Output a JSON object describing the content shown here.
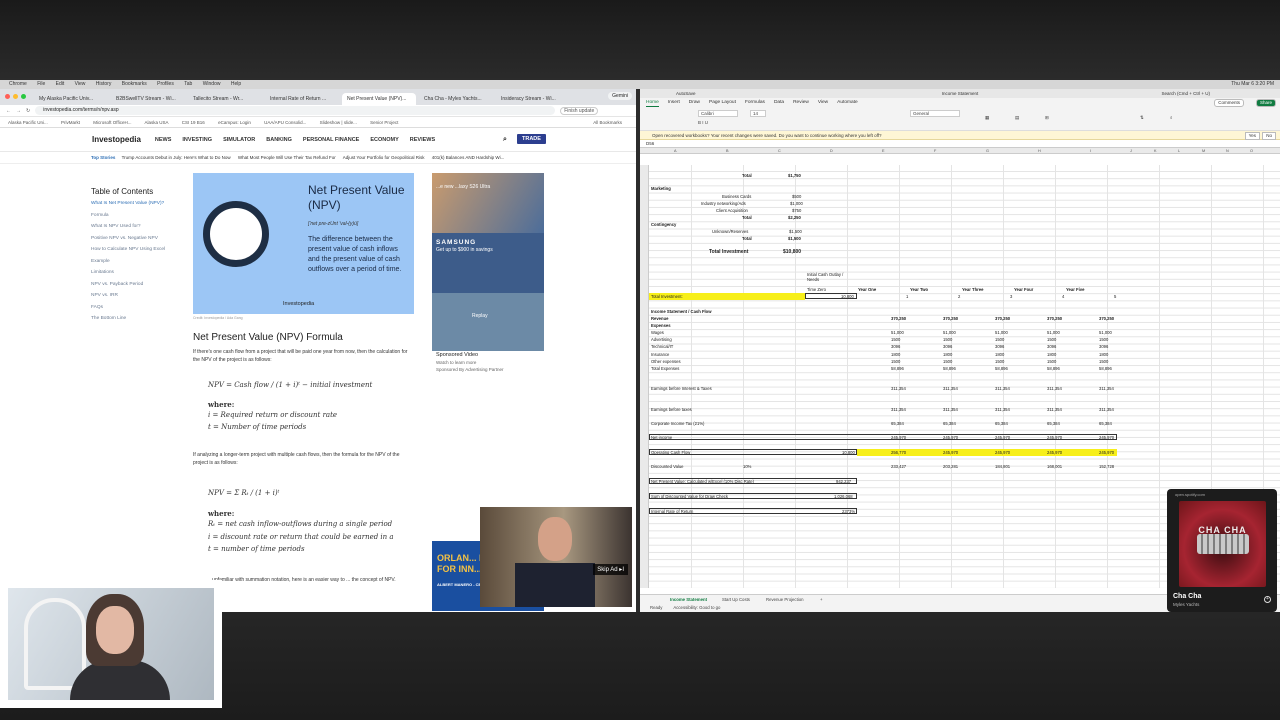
{
  "menubar": {
    "items": [
      "Chrome",
      "File",
      "Edit",
      "View",
      "History",
      "Bookmarks",
      "Profiles",
      "Tab",
      "Window",
      "Help"
    ],
    "clock": "Thu Mar 6  3:20 PM"
  },
  "browser": {
    "tabs": [
      "My Alaska Pacific Univ...",
      "B2BSwellTV Stream - Wi...",
      "Tallecito Stream - Wr...",
      "Internal Rate of Return ...",
      "Net Present Value (NPV)...",
      "Cha Cha - Myles Yachts...",
      "Insideracy Stream - Wi..."
    ],
    "gemini": "Gemini",
    "url": "investopedia.com/terms/n/npv.asp",
    "finish_update": "Finish update",
    "bookmarks": [
      "Alaska Pacific Uni...",
      "PrivMarkt",
      "Microsoft OfficeH...",
      "Alaska USA",
      "CSI 19 B16",
      "eCampus: Login",
      "UAA/APU Consolid...",
      "Slideshow | slide...",
      "Senior Project"
    ],
    "all_bookmarks": "All Bookmarks",
    "logo": "Investopedia",
    "nav": [
      "NEWS",
      "INVESTING",
      "SIMULATOR",
      "BANKING",
      "PERSONAL FINANCE",
      "ECONOMY",
      "REVIEWS"
    ],
    "trade": "TRADE",
    "top_stories_label": "Top Stories",
    "stories": [
      "Trump Accounts Debut in July: Here's What to Do Now",
      "What Most People Will Use Their Tax Refund For",
      "Adjust Your Portfolio for Geopolitical Risk",
      "401(k) Balances AND Hardship Wi..."
    ],
    "toc_title": "Table of Contents",
    "toc": [
      "What Is Net Present Value (NPV)?",
      "Formula",
      "What Is NPV Used for?",
      "Positive NPV vs. Negative NPV",
      "How to Calculate NPV Using Excel",
      "Example",
      "Limitations",
      "NPV vs. Payback Period",
      "NPV vs. IRR",
      "FAQs",
      "The Bottom Line"
    ],
    "hero_title": "Net Present Value (NPV)",
    "hero_pron": "['net pre-zUnt 'val-(y)ü]",
    "hero_def": "The difference between the present value of cash inflows and the present value of cash outflows over a period of time.",
    "hero_logo": "Investopedia",
    "credit": "Credit: Investopedia / Ada Gang",
    "formula_heading": "Net Present Value (NPV) Formula",
    "para1": "If there's one cash flow from a project that will be paid one year from now, then the calculation for the NPV of the project is as follows:",
    "f1": "NPV = Cash flow / (1 + i)ᵗ − initial investment",
    "where": "where:",
    "i_def": "i = Required return or discount rate",
    "t_def": "t = Number of time periods",
    "para2": "If analyzing a longer-term project with multiple cash flows, then the formula for the NPV of the project is as follows:",
    "f2": "NPV = Σ Rₜ / (1 + i)ᵗ",
    "where2": "where:",
    "r_def2": "Rₜ = net cash inflow-outflows during a single period",
    "i_def2": "i = discount rate or return that could be earned in a",
    "t_def2": "t = number of time periods",
    "para3": "...unfamiliar with summation notation, here is an easier way to ... the concept of NPV.",
    "ad_galaxy": "...e new ...laxy S26 Ultra",
    "ad_samsung": "SAMSUNG",
    "ad_savings": "Get up to $900 in savings",
    "ad_replay": "Replay",
    "sponsored_title": "Sponsored Video",
    "sponsored_sub": "Watch to learn more",
    "sponsored_by": "Sponsored By Advertising Partner",
    "ad_orlando": "ORLAN... INCRED... FOR INN...",
    "ad_orlando_sub": "ALBERT MANERO - CEO, LIMITLESS SOLUTIONS",
    "skip_ad": "Skip Ad ▸I"
  },
  "excel": {
    "title": "Income Statement",
    "autosave": "AutoSave",
    "search": "Search (Cmd + Ctrl + U)",
    "tabs": [
      "Home",
      "Insert",
      "Draw",
      "Page Layout",
      "Formulas",
      "Data",
      "Review",
      "View",
      "Automate"
    ],
    "comments": "Comments",
    "share": "Share",
    "font": "Calibri",
    "size": "14",
    "number_format": "General",
    "recovery": "Open recovered workbooks?  Your recent changes were saved. Do you want to continue working where you left off?",
    "yes": "Yes",
    "no": "No",
    "namebox": "D56",
    "columns": [
      "A",
      "B",
      "C",
      "D",
      "E",
      "F",
      "G",
      "H",
      "I",
      "J",
      "K",
      "L",
      "M",
      "N",
      "O"
    ],
    "rows": [
      {
        "r": "14",
        "a": "",
        "b": "Total",
        "c": "$1,750"
      },
      {
        "r": "18",
        "a": "Marketing"
      },
      {
        "r": "19",
        "b": "Business Cards",
        "c": "$500"
      },
      {
        "r": "20",
        "b": "Industry networking/Ads",
        "c": "$1,000"
      },
      {
        "r": "21",
        "b": "Client Acquisition",
        "c": "$750"
      },
      {
        "r": "22",
        "b": "Total",
        "c": "$2,250"
      },
      {
        "r": "23",
        "a": "Contingency"
      },
      {
        "r": "25",
        "b": "Unknown/Reserves",
        "c": "$1,500"
      },
      {
        "r": "26",
        "b": "Total",
        "c": "$1,500"
      },
      {
        "r": "28",
        "b": "Total Investment",
        "c": "$10,800"
      }
    ],
    "initial_outlay": "Initial Cash Outlay / Needs",
    "time_zero": "Time Zero",
    "years": [
      "Year One",
      "Year Two",
      "Year Three",
      "Year Four",
      "Year Five"
    ],
    "total_investment_label": "Total Investment:",
    "total_investment_value": "10,800",
    "year_nums": [
      "1",
      "2",
      "3",
      "4",
      "5"
    ],
    "section": "Income Statement / Cash Flow",
    "revenue_label": "Revenue",
    "revenue": "370,250",
    "expenses_label": "Expenses",
    "expense_rows": [
      {
        "label": "Wages",
        "v": "51,000"
      },
      {
        "label": "Advertising",
        "v": "1500"
      },
      {
        "label": "Technical/IT",
        "v": "3096"
      },
      {
        "label": "Insurance",
        "v": "1800"
      },
      {
        "label": "Other expenses",
        "v": "1500"
      },
      {
        "label": "Total Expenses",
        "v": "58,896"
      }
    ],
    "ebit_label": "Earnings before Interest & Taxes",
    "ebit": "311,354",
    "ebt_label": "Earnings before taxes",
    "ebt": "311,354",
    "tax_label": "Corporate Income Tax (21%)",
    "tax": "65,384",
    "ni_label": "Net income",
    "ni": "245,970",
    "ocf_label": "Operating Cash Flow",
    "ocf_zero": "10,800",
    "ocf": [
      "256,770",
      "245,970",
      "245,970",
      "245,970",
      "245,970"
    ],
    "dv_label": "Discounted Value",
    "dv_rate": "10%",
    "dv": [
      "233,427",
      "203,281",
      "184,801",
      "168,001",
      "152,728"
    ],
    "npv_label": "Net Present Value: Calculated w/Excel (10% Disc Rate)",
    "npv": "942,237",
    "sum_label": "Sum of Discounted Value for Draw Check",
    "sum": "1,026,068",
    "irr_label": "Internal Rate of Return",
    "irr": "2373%",
    "sheets": [
      "Income Statement",
      "Start Up Costs",
      "Revenue Projection"
    ],
    "status_ready": "Ready",
    "status_access": "Accessibility: Good to go"
  },
  "spotify": {
    "url": "open.spotify.com",
    "art_text": "CHA CHA",
    "track": "Cha Cha",
    "artist": "Myles Yachts"
  }
}
